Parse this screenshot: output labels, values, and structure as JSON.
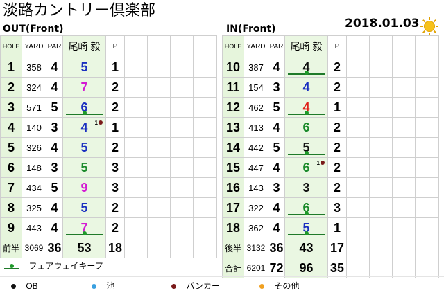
{
  "title": "淡路カントリー倶楽部",
  "date": "2018.01.03",
  "weather_icon": "sun-icon",
  "player": "尾崎 毅",
  "headers": {
    "hole": "HOLE",
    "yard": "YARD",
    "par": "PAR",
    "p": "P"
  },
  "out": {
    "label": "OUT(Front)",
    "holes": [
      {
        "hole": "1",
        "yard": "358",
        "par": "4",
        "score": "5",
        "color": "#1a2fc0",
        "p": "1",
        "fairway": false,
        "tag": ""
      },
      {
        "hole": "2",
        "yard": "324",
        "par": "4",
        "score": "7",
        "color": "#d31ad3",
        "p": "2",
        "fairway": false,
        "tag": ""
      },
      {
        "hole": "3",
        "yard": "571",
        "par": "5",
        "score": "6",
        "color": "#1a2fc0",
        "p": "2",
        "fairway": true,
        "tag": ""
      },
      {
        "hole": "4",
        "yard": "140",
        "par": "3",
        "score": "4",
        "color": "#1a2fc0",
        "p": "1",
        "fairway": false,
        "tag": "1"
      },
      {
        "hole": "5",
        "yard": "326",
        "par": "4",
        "score": "5",
        "color": "#1a2fc0",
        "p": "2",
        "fairway": false,
        "tag": ""
      },
      {
        "hole": "6",
        "yard": "148",
        "par": "3",
        "score": "5",
        "color": "#1a8a2a",
        "p": "3",
        "fairway": false,
        "tag": ""
      },
      {
        "hole": "7",
        "yard": "434",
        "par": "5",
        "score": "9",
        "color": "#d31ad3",
        "p": "3",
        "fairway": false,
        "tag": ""
      },
      {
        "hole": "8",
        "yard": "325",
        "par": "4",
        "score": "5",
        "color": "#1a2fc0",
        "p": "2",
        "fairway": false,
        "tag": ""
      },
      {
        "hole": "9",
        "yard": "443",
        "par": "4",
        "score": "7",
        "color": "#d31ad3",
        "p": "2",
        "fairway": true,
        "tag": ""
      }
    ],
    "summary": {
      "label": "前半",
      "yard": "3069",
      "par": "36",
      "score": "53",
      "p": "18"
    }
  },
  "in": {
    "label": "IN(Front)",
    "holes": [
      {
        "hole": "10",
        "yard": "387",
        "par": "4",
        "score": "4",
        "color": "#111111",
        "p": "2",
        "fairway": true,
        "tag": ""
      },
      {
        "hole": "11",
        "yard": "154",
        "par": "3",
        "score": "4",
        "color": "#1a2fc0",
        "p": "2",
        "fairway": false,
        "tag": ""
      },
      {
        "hole": "12",
        "yard": "462",
        "par": "5",
        "score": "4",
        "color": "#e0201a",
        "p": "1",
        "fairway": true,
        "tag": ""
      },
      {
        "hole": "13",
        "yard": "413",
        "par": "4",
        "score": "6",
        "color": "#1a8a2a",
        "p": "2",
        "fairway": false,
        "tag": ""
      },
      {
        "hole": "14",
        "yard": "442",
        "par": "5",
        "score": "5",
        "color": "#111111",
        "p": "2",
        "fairway": true,
        "tag": ""
      },
      {
        "hole": "15",
        "yard": "447",
        "par": "4",
        "score": "6",
        "color": "#1a8a2a",
        "p": "2",
        "fairway": false,
        "tag": "1"
      },
      {
        "hole": "16",
        "yard": "143",
        "par": "3",
        "score": "3",
        "color": "#111111",
        "p": "2",
        "fairway": false,
        "tag": ""
      },
      {
        "hole": "17",
        "yard": "322",
        "par": "4",
        "score": "6",
        "color": "#1a8a2a",
        "p": "3",
        "fairway": true,
        "tag": ""
      },
      {
        "hole": "18",
        "yard": "362",
        "par": "4",
        "score": "5",
        "color": "#1a2fc0",
        "p": "1",
        "fairway": true,
        "tag": ""
      }
    ],
    "summary": {
      "label": "後半",
      "yard": "3132",
      "par": "36",
      "score": "43",
      "p": "17"
    },
    "total": {
      "label": "合計",
      "yard": "6201",
      "par": "72",
      "score": "96",
      "p": "35"
    }
  },
  "legend": {
    "fairway": "= フェアウェイキープ",
    "ob": "= OB",
    "pond": "= 池",
    "bunker": "= バンカー",
    "other": "= その他"
  },
  "legend_colors": {
    "ob": "#111111",
    "pond": "#3aa0e0",
    "bunker": "#7a1a1a",
    "other": "#f0a020"
  }
}
